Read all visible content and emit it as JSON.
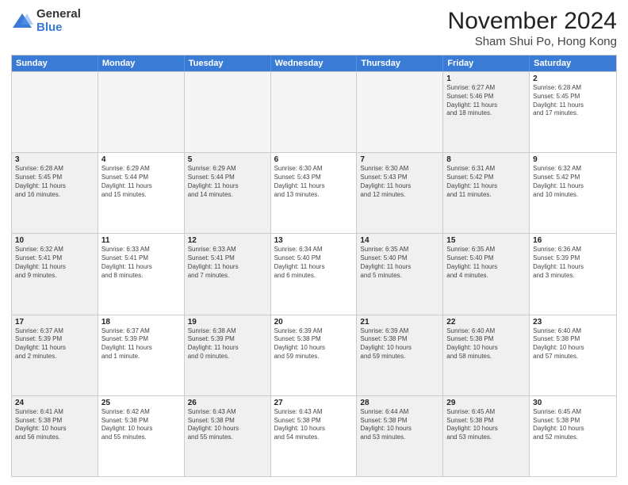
{
  "header": {
    "logo_general": "General",
    "logo_blue": "Blue",
    "main_title": "November 2024",
    "sub_title": "Sham Shui Po, Hong Kong"
  },
  "calendar": {
    "days_of_week": [
      "Sunday",
      "Monday",
      "Tuesday",
      "Wednesday",
      "Thursday",
      "Friday",
      "Saturday"
    ],
    "weeks": [
      [
        {
          "day": "",
          "info": "",
          "empty": true
        },
        {
          "day": "",
          "info": "",
          "empty": true
        },
        {
          "day": "",
          "info": "",
          "empty": true
        },
        {
          "day": "",
          "info": "",
          "empty": true
        },
        {
          "day": "",
          "info": "",
          "empty": true
        },
        {
          "day": "1",
          "info": "Sunrise: 6:27 AM\nSunset: 5:46 PM\nDaylight: 11 hours\nand 18 minutes.",
          "shaded": true
        },
        {
          "day": "2",
          "info": "Sunrise: 6:28 AM\nSunset: 5:45 PM\nDaylight: 11 hours\nand 17 minutes.",
          "shaded": false
        }
      ],
      [
        {
          "day": "3",
          "info": "Sunrise: 6:28 AM\nSunset: 5:45 PM\nDaylight: 11 hours\nand 16 minutes.",
          "shaded": true
        },
        {
          "day": "4",
          "info": "Sunrise: 6:29 AM\nSunset: 5:44 PM\nDaylight: 11 hours\nand 15 minutes.",
          "shaded": false
        },
        {
          "day": "5",
          "info": "Sunrise: 6:29 AM\nSunset: 5:44 PM\nDaylight: 11 hours\nand 14 minutes.",
          "shaded": true
        },
        {
          "day": "6",
          "info": "Sunrise: 6:30 AM\nSunset: 5:43 PM\nDaylight: 11 hours\nand 13 minutes.",
          "shaded": false
        },
        {
          "day": "7",
          "info": "Sunrise: 6:30 AM\nSunset: 5:43 PM\nDaylight: 11 hours\nand 12 minutes.",
          "shaded": true
        },
        {
          "day": "8",
          "info": "Sunrise: 6:31 AM\nSunset: 5:42 PM\nDaylight: 11 hours\nand 11 minutes.",
          "shaded": true
        },
        {
          "day": "9",
          "info": "Sunrise: 6:32 AM\nSunset: 5:42 PM\nDaylight: 11 hours\nand 10 minutes.",
          "shaded": false
        }
      ],
      [
        {
          "day": "10",
          "info": "Sunrise: 6:32 AM\nSunset: 5:41 PM\nDaylight: 11 hours\nand 9 minutes.",
          "shaded": true
        },
        {
          "day": "11",
          "info": "Sunrise: 6:33 AM\nSunset: 5:41 PM\nDaylight: 11 hours\nand 8 minutes.",
          "shaded": false
        },
        {
          "day": "12",
          "info": "Sunrise: 6:33 AM\nSunset: 5:41 PM\nDaylight: 11 hours\nand 7 minutes.",
          "shaded": true
        },
        {
          "day": "13",
          "info": "Sunrise: 6:34 AM\nSunset: 5:40 PM\nDaylight: 11 hours\nand 6 minutes.",
          "shaded": false
        },
        {
          "day": "14",
          "info": "Sunrise: 6:35 AM\nSunset: 5:40 PM\nDaylight: 11 hours\nand 5 minutes.",
          "shaded": true
        },
        {
          "day": "15",
          "info": "Sunrise: 6:35 AM\nSunset: 5:40 PM\nDaylight: 11 hours\nand 4 minutes.",
          "shaded": true
        },
        {
          "day": "16",
          "info": "Sunrise: 6:36 AM\nSunset: 5:39 PM\nDaylight: 11 hours\nand 3 minutes.",
          "shaded": false
        }
      ],
      [
        {
          "day": "17",
          "info": "Sunrise: 6:37 AM\nSunset: 5:39 PM\nDaylight: 11 hours\nand 2 minutes.",
          "shaded": true
        },
        {
          "day": "18",
          "info": "Sunrise: 6:37 AM\nSunset: 5:39 PM\nDaylight: 11 hours\nand 1 minute.",
          "shaded": false
        },
        {
          "day": "19",
          "info": "Sunrise: 6:38 AM\nSunset: 5:39 PM\nDaylight: 11 hours\nand 0 minutes.",
          "shaded": true
        },
        {
          "day": "20",
          "info": "Sunrise: 6:39 AM\nSunset: 5:38 PM\nDaylight: 10 hours\nand 59 minutes.",
          "shaded": false
        },
        {
          "day": "21",
          "info": "Sunrise: 6:39 AM\nSunset: 5:38 PM\nDaylight: 10 hours\nand 59 minutes.",
          "shaded": true
        },
        {
          "day": "22",
          "info": "Sunrise: 6:40 AM\nSunset: 5:38 PM\nDaylight: 10 hours\nand 58 minutes.",
          "shaded": true
        },
        {
          "day": "23",
          "info": "Sunrise: 6:40 AM\nSunset: 5:38 PM\nDaylight: 10 hours\nand 57 minutes.",
          "shaded": false
        }
      ],
      [
        {
          "day": "24",
          "info": "Sunrise: 6:41 AM\nSunset: 5:38 PM\nDaylight: 10 hours\nand 56 minutes.",
          "shaded": true
        },
        {
          "day": "25",
          "info": "Sunrise: 6:42 AM\nSunset: 5:38 PM\nDaylight: 10 hours\nand 55 minutes.",
          "shaded": false
        },
        {
          "day": "26",
          "info": "Sunrise: 6:43 AM\nSunset: 5:38 PM\nDaylight: 10 hours\nand 55 minutes.",
          "shaded": true
        },
        {
          "day": "27",
          "info": "Sunrise: 6:43 AM\nSunset: 5:38 PM\nDaylight: 10 hours\nand 54 minutes.",
          "shaded": false
        },
        {
          "day": "28",
          "info": "Sunrise: 6:44 AM\nSunset: 5:38 PM\nDaylight: 10 hours\nand 53 minutes.",
          "shaded": true
        },
        {
          "day": "29",
          "info": "Sunrise: 6:45 AM\nSunset: 5:38 PM\nDaylight: 10 hours\nand 53 minutes.",
          "shaded": true
        },
        {
          "day": "30",
          "info": "Sunrise: 6:45 AM\nSunset: 5:38 PM\nDaylight: 10 hours\nand 52 minutes.",
          "shaded": false
        }
      ]
    ]
  }
}
